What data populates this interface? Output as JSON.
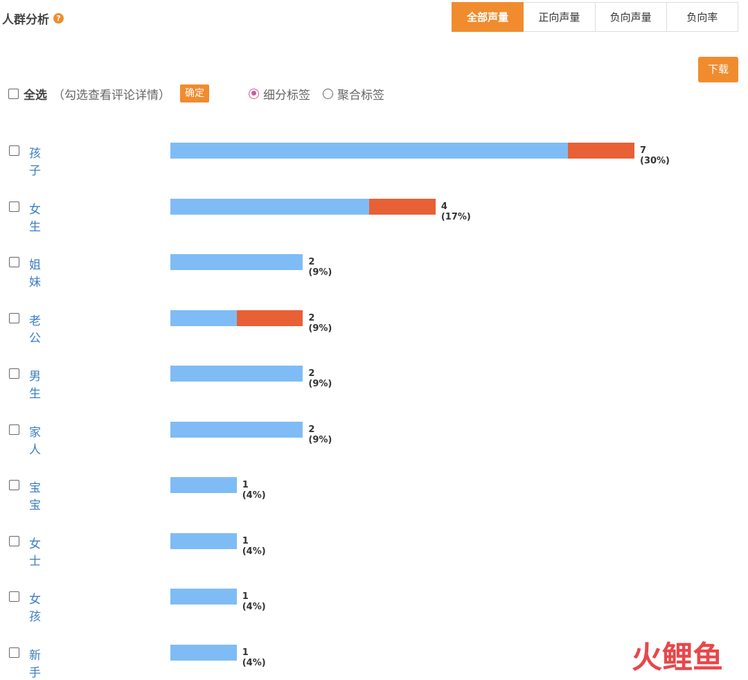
{
  "header": {
    "title": "人群分析",
    "help_glyph": "?"
  },
  "tabs": [
    {
      "label": "全部声量",
      "active": true
    },
    {
      "label": "正向声量",
      "active": false
    },
    {
      "label": "负向声量",
      "active": false
    },
    {
      "label": "负向率",
      "active": false
    }
  ],
  "download_label": "下载",
  "toolbar": {
    "select_all_label": "全选",
    "hint": "（勾选查看评论详情）",
    "confirm_label": "确定",
    "radios": [
      {
        "label": "细分标签",
        "checked": true
      },
      {
        "label": "聚合标签",
        "checked": false
      }
    ]
  },
  "colors": {
    "accent": "#f08c2e",
    "positive": "#7fbcf5",
    "negative": "#e86035",
    "label": "#3a7dc2",
    "radio_active": "#d0579a"
  },
  "chart_data": {
    "type": "bar",
    "orientation": "horizontal",
    "stacked": true,
    "categories": [
      "孩子",
      "女生",
      "姐妹",
      "老公",
      "男生",
      "家人",
      "宝宝",
      "女士",
      "女孩",
      "新手"
    ],
    "series": [
      {
        "values": [
          6,
          3,
          2,
          1,
          2,
          2,
          1,
          1,
          1,
          1
        ],
        "color": "#7fbcf5"
      },
      {
        "values": [
          1,
          1,
          0,
          1,
          0,
          0,
          0,
          0,
          0,
          0
        ],
        "color": "#e86035"
      }
    ],
    "totals": [
      7,
      4,
      2,
      2,
      2,
      2,
      1,
      1,
      1,
      1
    ],
    "value_labels": [
      "7 (30%)",
      "4 (17%)",
      "2 (9%)",
      "2 (9%)",
      "2 (9%)",
      "2 (9%)",
      "1 (4%)",
      "1 (4%)",
      "1 (4%)",
      "1 (4%)"
    ],
    "xlim": [
      0,
      7
    ],
    "grid": false
  },
  "watermark": {
    "chars": [
      "火",
      "鲤",
      "鱼"
    ],
    "colors": [
      "#e8474a",
      "#e8474a",
      "#e8474a"
    ]
  }
}
